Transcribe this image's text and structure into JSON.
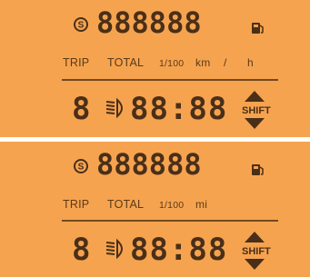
{
  "top": {
    "odometer_digits": "888888",
    "labels": {
      "trip": "TRIP",
      "total": "TOTAL",
      "unit": "1/100",
      "distance": "km",
      "slash": "/",
      "time": "h"
    },
    "gear_digit": "8",
    "time_digits": "88:88",
    "shift_label": "SHIFT"
  },
  "bottom": {
    "odometer_digits": "888888",
    "labels": {
      "trip": "TRIP",
      "total": "TOTAL",
      "unit": "1/100",
      "distance": "mi"
    },
    "gear_digit": "8",
    "time_digits": "88:88",
    "shift_label": "SHIFT"
  },
  "colors": {
    "panel_bg": "#f6a34f",
    "segment": "#4a2f18",
    "divider": "#ffffff"
  },
  "icons": [
    "s-icon",
    "fuel-pump-icon",
    "headlight-beam-icon",
    "shift-up-arrow-icon",
    "shift-down-arrow-icon"
  ]
}
